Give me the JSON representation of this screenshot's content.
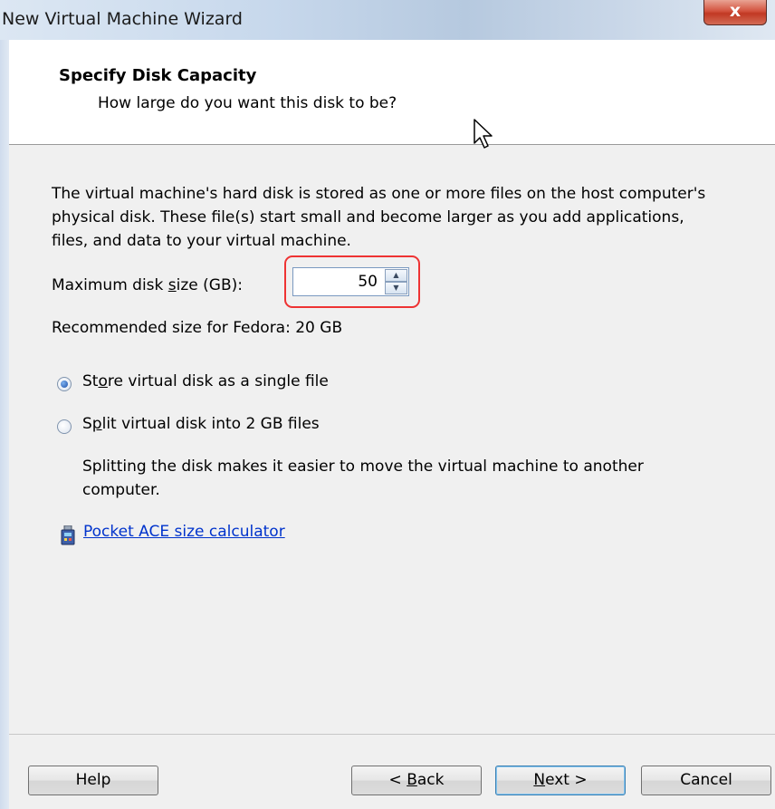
{
  "window": {
    "title": "New Virtual Machine Wizard",
    "close_label": "x"
  },
  "header": {
    "title": "Specify Disk Capacity",
    "subtitle": "How large do you want this disk to be?"
  },
  "main": {
    "description": "The virtual machine's hard disk is stored as one or more files on the host computer's physical disk. These file(s) start small and become larger as you add applications, files, and data to your virtual machine.",
    "max_disk_label_pre": "Maximum disk ",
    "max_disk_label_ul": "s",
    "max_disk_label_post": "ize (GB):",
    "max_disk_value": "50",
    "recommended": "Recommended size for Fedora: 20 GB",
    "radio_single_pre": "St",
    "radio_single_ul": "o",
    "radio_single_post": "re virtual disk as a single file",
    "radio_split_pre": "S",
    "radio_split_ul": "p",
    "radio_split_post": "lit virtual disk into 2 GB files",
    "split_description": "Splitting the disk makes it easier to move the virtual machine to another computer.",
    "ace_link": "Pocket ACE size calculator",
    "selected_option": "single"
  },
  "buttons": {
    "help": "Help",
    "back_pre": "< ",
    "back_ul": "B",
    "back_post": "ack",
    "next_ul": "N",
    "next_post": "ext >",
    "cancel": "Cancel"
  },
  "colors": {
    "highlight": "#e33333",
    "link": "#0033cc"
  }
}
